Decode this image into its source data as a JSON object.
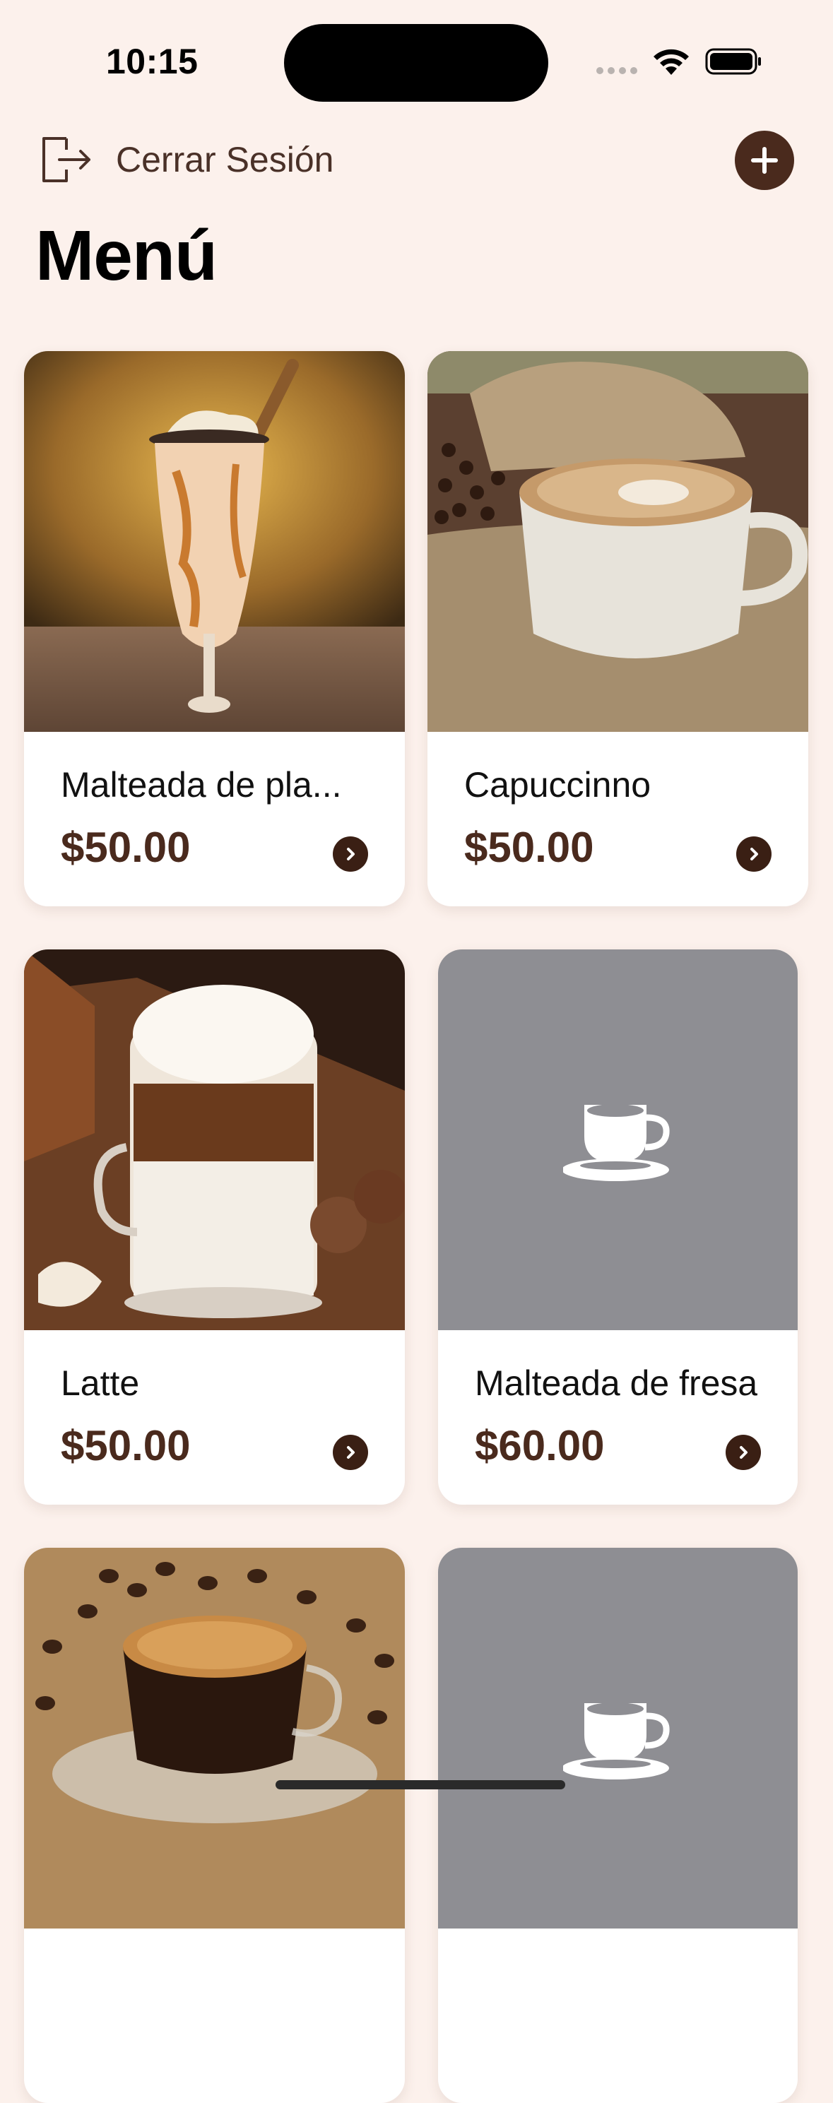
{
  "status_bar": {
    "time": "10:15"
  },
  "header": {
    "logout_label": "Cerrar Sesión",
    "title": "Menú"
  },
  "menu": {
    "items": [
      {
        "name": "Malteada de pla...",
        "price": "$50.00",
        "image": "milkshake-photo"
      },
      {
        "name": "Capuccinno",
        "price": "$50.00",
        "image": "cappuccino-photo"
      },
      {
        "name": "Latte",
        "price": "$50.00",
        "image": "latte-photo"
      },
      {
        "name": "Malteada de fresa",
        "price": "$60.00",
        "image": "cup-placeholder-icon"
      },
      {
        "name": "",
        "price": "",
        "image": "espresso-photo"
      },
      {
        "name": "",
        "price": "",
        "image": "cup-placeholder-icon"
      }
    ]
  },
  "colors": {
    "background": "#fcf1ec",
    "accent": "#4a2a1d",
    "placeholder": "#8e8e93"
  }
}
